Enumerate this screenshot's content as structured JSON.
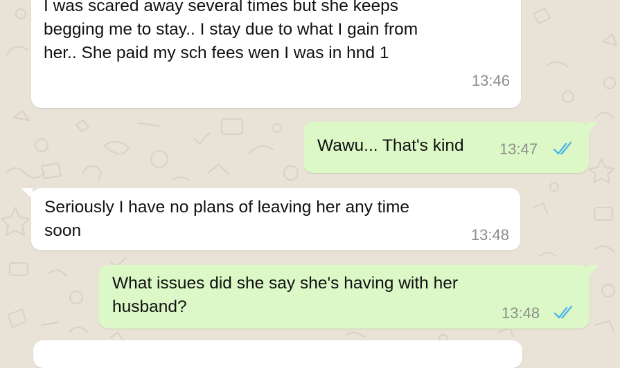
{
  "messages": [
    {
      "direction": "incoming",
      "text": "I was scared away several times but she keeps\nbegging me to stay..  I stay due to what I gain from\nher.. She paid my sch fees wen I was in hnd 1",
      "time": "13:46"
    },
    {
      "direction": "outgoing",
      "text": "Wawu... That's kind",
      "time": "13:47",
      "status": "read-double-check-icon"
    },
    {
      "direction": "incoming",
      "text": "Seriously I have no plans of leaving her any time\nsoon",
      "time": "13:48"
    },
    {
      "direction": "outgoing",
      "text": "What issues did she say she's having with her\nhusband?",
      "time": "13:48",
      "status": "read-double-check-icon"
    },
    {
      "direction": "incoming",
      "text": "",
      "time": ""
    }
  ],
  "colors": {
    "background": "#e9e2d7",
    "incoming_bubble": "#ffffff",
    "outgoing_bubble": "#dcf8c6",
    "read_ticks": "#4fb6ec",
    "timestamp": "#8c8c8c"
  }
}
